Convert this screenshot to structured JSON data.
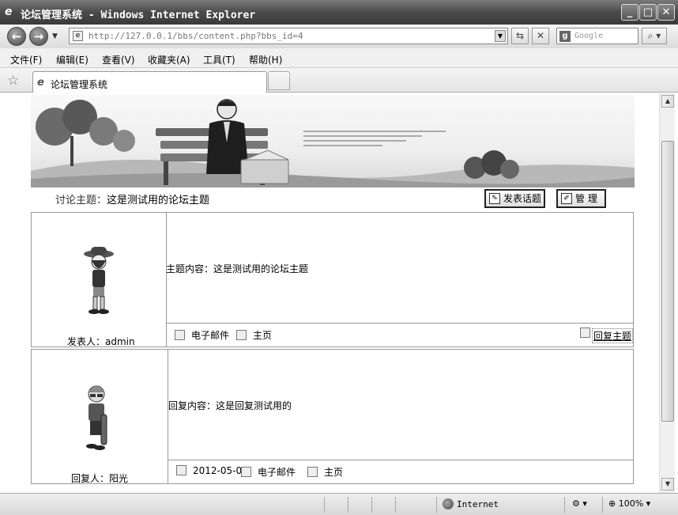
{
  "window": {
    "title": "论坛管理系统 - Windows Internet Explorer"
  },
  "nav": {
    "url": "http://127.0.0.1/bbs/content.php?bbs_id=4",
    "search_placeholder": "Google"
  },
  "menu": {
    "items": [
      "文件(F)",
      "编辑(E)",
      "查看(V)",
      "收藏夹(A)",
      "工具(T)",
      "帮助(H)"
    ]
  },
  "tab": {
    "label": "论坛管理系统"
  },
  "page": {
    "topic_label": "讨论主题：",
    "topic_title": "这是测试用的论坛主题",
    "post_button": "发表话题",
    "manage_button": "管 理",
    "main_post": {
      "poster_label": "发表人：",
      "poster": "admin",
      "content_label": "主题内容：",
      "content": "这是测试用的论坛主题",
      "email_label": "电子邮件",
      "home_label": "主页",
      "reply_link": "回复主题"
    },
    "reply_post": {
      "poster_label": "回复人：",
      "poster": "阳光",
      "content_label": "回复内容：",
      "content": "这是回复测试用的",
      "date": "2012-05-07",
      "email_label": "电子邮件",
      "home_label": "主页"
    }
  },
  "status": {
    "zone": "Internet",
    "zoom": "100%"
  }
}
